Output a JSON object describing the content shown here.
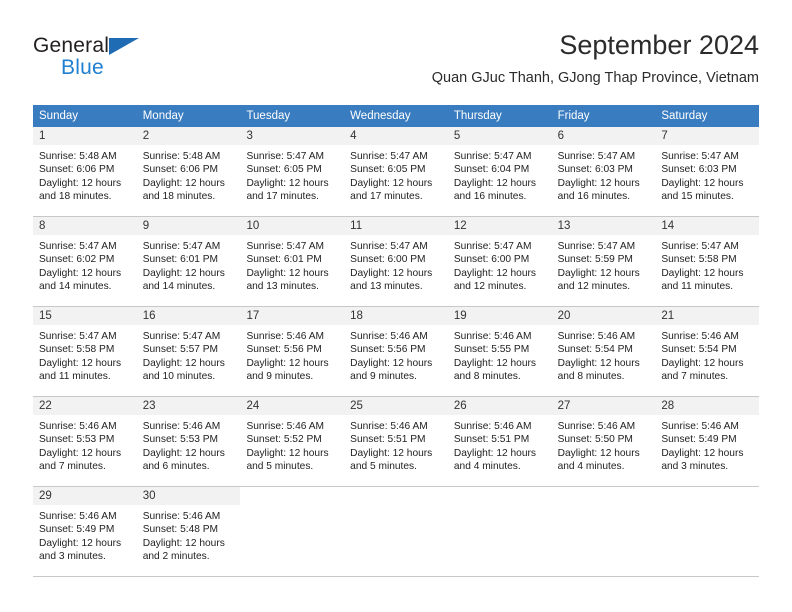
{
  "brand": {
    "name_top": "General",
    "name_bottom": "Blue",
    "accent_color": "#1f7fd0",
    "triangle_color": "#1f6cb5"
  },
  "header": {
    "title": "September 2024",
    "subtitle": "Quan GJuc Thanh, GJong Thap Province, Vietnam"
  },
  "calendar": {
    "header_bg": "#3a7cc0",
    "daynum_bg": "#f2f2f2",
    "weekdays": [
      "Sunday",
      "Monday",
      "Tuesday",
      "Wednesday",
      "Thursday",
      "Friday",
      "Saturday"
    ],
    "weeks": [
      [
        {
          "day": "1",
          "sunrise": "Sunrise: 5:48 AM",
          "sunset": "Sunset: 6:06 PM",
          "daylight1": "Daylight: 12 hours",
          "daylight2": "and 18 minutes."
        },
        {
          "day": "2",
          "sunrise": "Sunrise: 5:48 AM",
          "sunset": "Sunset: 6:06 PM",
          "daylight1": "Daylight: 12 hours",
          "daylight2": "and 18 minutes."
        },
        {
          "day": "3",
          "sunrise": "Sunrise: 5:47 AM",
          "sunset": "Sunset: 6:05 PM",
          "daylight1": "Daylight: 12 hours",
          "daylight2": "and 17 minutes."
        },
        {
          "day": "4",
          "sunrise": "Sunrise: 5:47 AM",
          "sunset": "Sunset: 6:05 PM",
          "daylight1": "Daylight: 12 hours",
          "daylight2": "and 17 minutes."
        },
        {
          "day": "5",
          "sunrise": "Sunrise: 5:47 AM",
          "sunset": "Sunset: 6:04 PM",
          "daylight1": "Daylight: 12 hours",
          "daylight2": "and 16 minutes."
        },
        {
          "day": "6",
          "sunrise": "Sunrise: 5:47 AM",
          "sunset": "Sunset: 6:03 PM",
          "daylight1": "Daylight: 12 hours",
          "daylight2": "and 16 minutes."
        },
        {
          "day": "7",
          "sunrise": "Sunrise: 5:47 AM",
          "sunset": "Sunset: 6:03 PM",
          "daylight1": "Daylight: 12 hours",
          "daylight2": "and 15 minutes."
        }
      ],
      [
        {
          "day": "8",
          "sunrise": "Sunrise: 5:47 AM",
          "sunset": "Sunset: 6:02 PM",
          "daylight1": "Daylight: 12 hours",
          "daylight2": "and 14 minutes."
        },
        {
          "day": "9",
          "sunrise": "Sunrise: 5:47 AM",
          "sunset": "Sunset: 6:01 PM",
          "daylight1": "Daylight: 12 hours",
          "daylight2": "and 14 minutes."
        },
        {
          "day": "10",
          "sunrise": "Sunrise: 5:47 AM",
          "sunset": "Sunset: 6:01 PM",
          "daylight1": "Daylight: 12 hours",
          "daylight2": "and 13 minutes."
        },
        {
          "day": "11",
          "sunrise": "Sunrise: 5:47 AM",
          "sunset": "Sunset: 6:00 PM",
          "daylight1": "Daylight: 12 hours",
          "daylight2": "and 13 minutes."
        },
        {
          "day": "12",
          "sunrise": "Sunrise: 5:47 AM",
          "sunset": "Sunset: 6:00 PM",
          "daylight1": "Daylight: 12 hours",
          "daylight2": "and 12 minutes."
        },
        {
          "day": "13",
          "sunrise": "Sunrise: 5:47 AM",
          "sunset": "Sunset: 5:59 PM",
          "daylight1": "Daylight: 12 hours",
          "daylight2": "and 12 minutes."
        },
        {
          "day": "14",
          "sunrise": "Sunrise: 5:47 AM",
          "sunset": "Sunset: 5:58 PM",
          "daylight1": "Daylight: 12 hours",
          "daylight2": "and 11 minutes."
        }
      ],
      [
        {
          "day": "15",
          "sunrise": "Sunrise: 5:47 AM",
          "sunset": "Sunset: 5:58 PM",
          "daylight1": "Daylight: 12 hours",
          "daylight2": "and 11 minutes."
        },
        {
          "day": "16",
          "sunrise": "Sunrise: 5:47 AM",
          "sunset": "Sunset: 5:57 PM",
          "daylight1": "Daylight: 12 hours",
          "daylight2": "and 10 minutes."
        },
        {
          "day": "17",
          "sunrise": "Sunrise: 5:46 AM",
          "sunset": "Sunset: 5:56 PM",
          "daylight1": "Daylight: 12 hours",
          "daylight2": "and 9 minutes."
        },
        {
          "day": "18",
          "sunrise": "Sunrise: 5:46 AM",
          "sunset": "Sunset: 5:56 PM",
          "daylight1": "Daylight: 12 hours",
          "daylight2": "and 9 minutes."
        },
        {
          "day": "19",
          "sunrise": "Sunrise: 5:46 AM",
          "sunset": "Sunset: 5:55 PM",
          "daylight1": "Daylight: 12 hours",
          "daylight2": "and 8 minutes."
        },
        {
          "day": "20",
          "sunrise": "Sunrise: 5:46 AM",
          "sunset": "Sunset: 5:54 PM",
          "daylight1": "Daylight: 12 hours",
          "daylight2": "and 8 minutes."
        },
        {
          "day": "21",
          "sunrise": "Sunrise: 5:46 AM",
          "sunset": "Sunset: 5:54 PM",
          "daylight1": "Daylight: 12 hours",
          "daylight2": "and 7 minutes."
        }
      ],
      [
        {
          "day": "22",
          "sunrise": "Sunrise: 5:46 AM",
          "sunset": "Sunset: 5:53 PM",
          "daylight1": "Daylight: 12 hours",
          "daylight2": "and 7 minutes."
        },
        {
          "day": "23",
          "sunrise": "Sunrise: 5:46 AM",
          "sunset": "Sunset: 5:53 PM",
          "daylight1": "Daylight: 12 hours",
          "daylight2": "and 6 minutes."
        },
        {
          "day": "24",
          "sunrise": "Sunrise: 5:46 AM",
          "sunset": "Sunset: 5:52 PM",
          "daylight1": "Daylight: 12 hours",
          "daylight2": "and 5 minutes."
        },
        {
          "day": "25",
          "sunrise": "Sunrise: 5:46 AM",
          "sunset": "Sunset: 5:51 PM",
          "daylight1": "Daylight: 12 hours",
          "daylight2": "and 5 minutes."
        },
        {
          "day": "26",
          "sunrise": "Sunrise: 5:46 AM",
          "sunset": "Sunset: 5:51 PM",
          "daylight1": "Daylight: 12 hours",
          "daylight2": "and 4 minutes."
        },
        {
          "day": "27",
          "sunrise": "Sunrise: 5:46 AM",
          "sunset": "Sunset: 5:50 PM",
          "daylight1": "Daylight: 12 hours",
          "daylight2": "and 4 minutes."
        },
        {
          "day": "28",
          "sunrise": "Sunrise: 5:46 AM",
          "sunset": "Sunset: 5:49 PM",
          "daylight1": "Daylight: 12 hours",
          "daylight2": "and 3 minutes."
        }
      ],
      [
        {
          "day": "29",
          "sunrise": "Sunrise: 5:46 AM",
          "sunset": "Sunset: 5:49 PM",
          "daylight1": "Daylight: 12 hours",
          "daylight2": "and 3 minutes."
        },
        {
          "day": "30",
          "sunrise": "Sunrise: 5:46 AM",
          "sunset": "Sunset: 5:48 PM",
          "daylight1": "Daylight: 12 hours",
          "daylight2": "and 2 minutes."
        },
        {
          "day": "",
          "sunrise": "",
          "sunset": "",
          "daylight1": "",
          "daylight2": ""
        },
        {
          "day": "",
          "sunrise": "",
          "sunset": "",
          "daylight1": "",
          "daylight2": ""
        },
        {
          "day": "",
          "sunrise": "",
          "sunset": "",
          "daylight1": "",
          "daylight2": ""
        },
        {
          "day": "",
          "sunrise": "",
          "sunset": "",
          "daylight1": "",
          "daylight2": ""
        },
        {
          "day": "",
          "sunrise": "",
          "sunset": "",
          "daylight1": "",
          "daylight2": ""
        }
      ]
    ]
  }
}
